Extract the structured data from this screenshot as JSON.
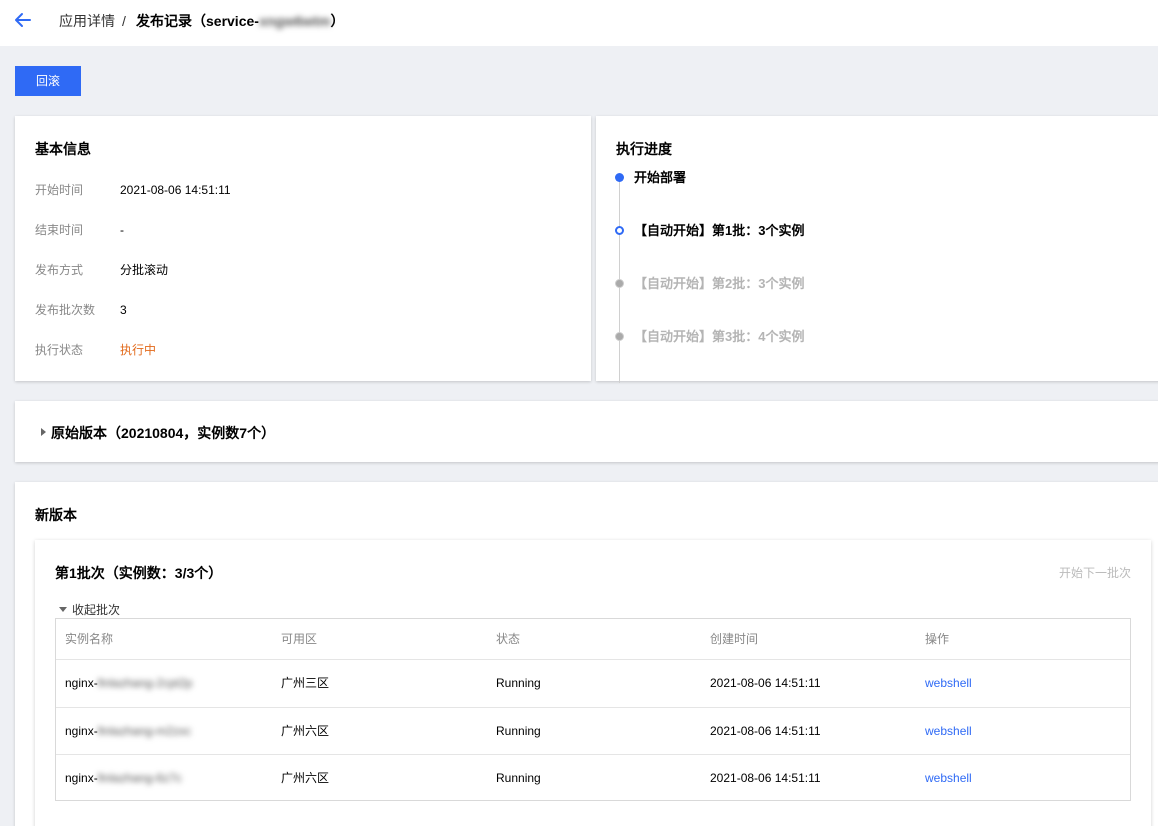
{
  "header": {
    "back_icon": "arrow-left-icon",
    "breadcrumb_parent": "应用详情",
    "separator": "/",
    "current_prefix": "发布记录（service-",
    "current_blurred": "xngw6wtm",
    "current_suffix": "）"
  },
  "toolbar": {
    "rollback_label": "回滚"
  },
  "basic_info": {
    "title": "基本信息",
    "rows": [
      {
        "label": "开始时间",
        "value": "2021-08-06 14:51:11"
      },
      {
        "label": "结束时间",
        "value": "-"
      },
      {
        "label": "发布方式",
        "value": "分批滚动"
      },
      {
        "label": "发布批次数",
        "value": "3"
      },
      {
        "label": "执行状态",
        "value": "执行中"
      }
    ]
  },
  "progress": {
    "title": "执行进度",
    "steps": [
      {
        "label": "开始部署",
        "state": "done"
      },
      {
        "label": "【自动开始】第1批：3个实例",
        "state": "active"
      },
      {
        "label": "【自动开始】第2批：3个实例",
        "state": "pending"
      },
      {
        "label": "【自动开始】第3批：4个实例",
        "state": "pending"
      }
    ]
  },
  "original_version": {
    "title": "原始版本（20210804，实例数7个）"
  },
  "new_version": {
    "title": "新版本",
    "batch": {
      "title": "第1批次（实例数：3/3个）",
      "next_batch_label": "开始下一批次",
      "collapse_label": "收起批次",
      "columns": [
        "实例名称",
        "可用区",
        "状态",
        "创建时间",
        "操作"
      ],
      "rows": [
        {
          "name_prefix": "nginx-",
          "name_blurred": "finlazhang-2cpt2p",
          "zone": "广州三区",
          "status": "Running",
          "created": "2021-08-06 14:51:11",
          "action": "webshell"
        },
        {
          "name_prefix": "nginx-",
          "name_blurred": "finlazhang-m2zxc",
          "zone": "广州六区",
          "status": "Running",
          "created": "2021-08-06 14:51:11",
          "action": "webshell"
        },
        {
          "name_prefix": "nginx-",
          "name_blurred": "finlazhang-6z7c",
          "zone": "广州六区",
          "status": "Running",
          "created": "2021-08-06 14:51:11",
          "action": "webshell"
        }
      ]
    }
  },
  "colors": {
    "primary": "#2f6af5",
    "running": "#e26a1b",
    "pending": "#b4b4b4"
  }
}
